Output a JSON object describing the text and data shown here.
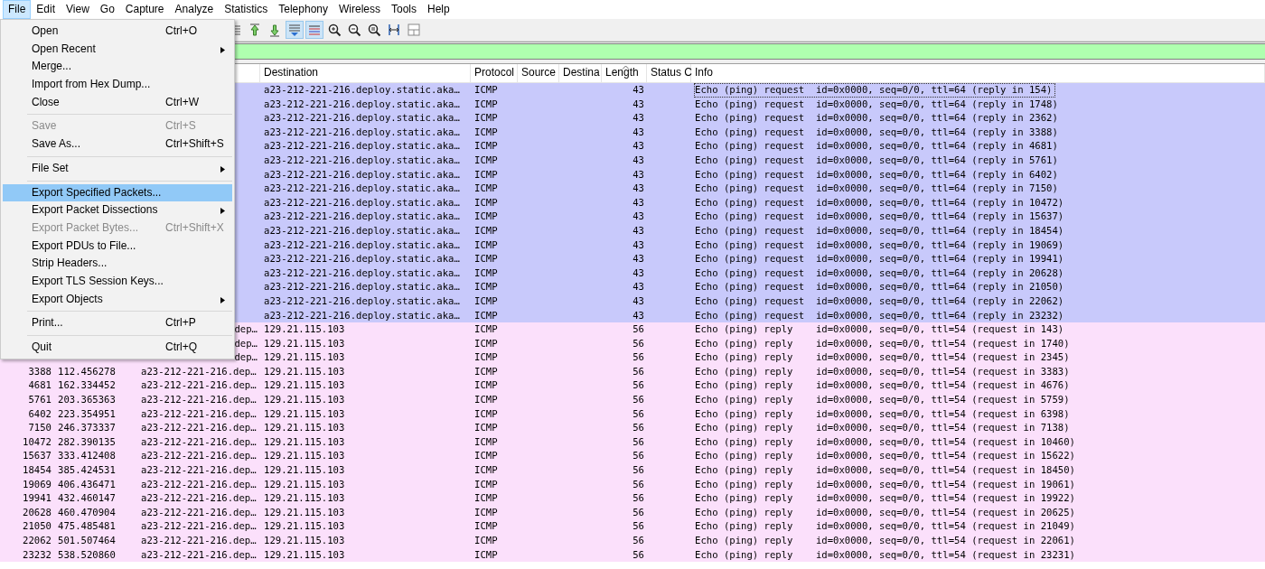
{
  "menubar": [
    {
      "label": "File",
      "selected": true
    },
    {
      "label": "Edit",
      "selected": false
    },
    {
      "label": "View",
      "selected": false
    },
    {
      "label": "Go",
      "selected": false
    },
    {
      "label": "Capture",
      "selected": false
    },
    {
      "label": "Analyze",
      "selected": false
    },
    {
      "label": "Statistics",
      "selected": false
    },
    {
      "label": "Telephony",
      "selected": false
    },
    {
      "label": "Wireless",
      "selected": false
    },
    {
      "label": "Tools",
      "selected": false
    },
    {
      "label": "Help",
      "selected": false
    }
  ],
  "file_menu": [
    {
      "kind": "item",
      "label": "Open",
      "shortcut": "Ctrl+O",
      "submenu": false,
      "disabled": false,
      "selected": false
    },
    {
      "kind": "item",
      "label": "Open Recent",
      "submenu": true,
      "disabled": false,
      "selected": false
    },
    {
      "kind": "item",
      "label": "Merge...",
      "submenu": false,
      "disabled": false,
      "selected": false
    },
    {
      "kind": "item",
      "label": "Import from Hex Dump...",
      "submenu": false,
      "disabled": false,
      "selected": false
    },
    {
      "kind": "item",
      "label": "Close",
      "shortcut": "Ctrl+W",
      "submenu": false,
      "disabled": false,
      "selected": false
    },
    {
      "kind": "separator"
    },
    {
      "kind": "item",
      "label": "Save",
      "shortcut": "Ctrl+S",
      "submenu": false,
      "disabled": true,
      "selected": false
    },
    {
      "kind": "item",
      "label": "Save As...",
      "shortcut": "Ctrl+Shift+S",
      "submenu": false,
      "disabled": false,
      "selected": false
    },
    {
      "kind": "separator"
    },
    {
      "kind": "item",
      "label": "File Set",
      "submenu": true,
      "disabled": false,
      "selected": false
    },
    {
      "kind": "separator"
    },
    {
      "kind": "item",
      "label": "Export Specified Packets...",
      "submenu": false,
      "disabled": false,
      "selected": true
    },
    {
      "kind": "item",
      "label": "Export Packet Dissections",
      "submenu": true,
      "disabled": false,
      "selected": false
    },
    {
      "kind": "item",
      "label": "Export Packet Bytes...",
      "shortcut": "Ctrl+Shift+X",
      "submenu": false,
      "disabled": true,
      "selected": false
    },
    {
      "kind": "item",
      "label": "Export PDUs to File...",
      "submenu": false,
      "disabled": false,
      "selected": false
    },
    {
      "kind": "item",
      "label": "Strip Headers...",
      "submenu": false,
      "disabled": false,
      "selected": false
    },
    {
      "kind": "item",
      "label": "Export TLS Session Keys...",
      "submenu": false,
      "disabled": false,
      "selected": false
    },
    {
      "kind": "item",
      "label": "Export Objects",
      "submenu": true,
      "disabled": false,
      "selected": false
    },
    {
      "kind": "separator"
    },
    {
      "kind": "item",
      "label": "Print...",
      "shortcut": "Ctrl+P",
      "submenu": false,
      "disabled": false,
      "selected": false
    },
    {
      "kind": "separator"
    },
    {
      "kind": "item",
      "label": "Quit",
      "shortcut": "Ctrl+Q",
      "submenu": false,
      "disabled": false,
      "selected": false
    }
  ],
  "toolbar": [
    {
      "kind": "lines",
      "pressed": false
    },
    {
      "kind": "first",
      "pressed": false
    },
    {
      "kind": "last",
      "pressed": false
    },
    {
      "kind": "autoscroll",
      "pressed": true
    },
    {
      "kind": "colorize",
      "pressed": true
    },
    {
      "kind": "zoomin",
      "pressed": false
    },
    {
      "kind": "zoomout",
      "pressed": false
    },
    {
      "kind": "zoomreset",
      "pressed": false
    },
    {
      "kind": "resize",
      "pressed": false
    },
    {
      "kind": "layout",
      "pressed": false
    }
  ],
  "packet_list": {
    "columns": [
      {
        "label": "Destination",
        "sorted": false
      },
      {
        "label": "Protocol",
        "sorted": false
      },
      {
        "label": "Source",
        "sorted": false
      },
      {
        "label": "Destina",
        "sorted": false
      },
      {
        "label": "Length",
        "sorted": true
      },
      {
        "label": "Status C",
        "sorted": false
      },
      {
        "label": "Info",
        "sorted": false
      }
    ],
    "rows": [
      {
        "kind": "request",
        "focused": true,
        "destination": "a23-212-221-216.deploy.static.aka…",
        "protocol": "ICMP",
        "length": "43",
        "info": "Echo (ping) request  id=0x0000, seq=0/0, ttl=64 (reply in 154)"
      },
      {
        "kind": "request",
        "focused": false,
        "destination": "a23-212-221-216.deploy.static.aka…",
        "protocol": "ICMP",
        "length": "43",
        "info": "Echo (ping) request  id=0x0000, seq=0/0, ttl=64 (reply in 1748)"
      },
      {
        "kind": "request",
        "focused": false,
        "destination": "a23-212-221-216.deploy.static.aka…",
        "protocol": "ICMP",
        "length": "43",
        "info": "Echo (ping) request  id=0x0000, seq=0/0, ttl=64 (reply in 2362)"
      },
      {
        "kind": "request",
        "focused": false,
        "destination": "a23-212-221-216.deploy.static.aka…",
        "protocol": "ICMP",
        "length": "43",
        "info": "Echo (ping) request  id=0x0000, seq=0/0, ttl=64 (reply in 3388)"
      },
      {
        "kind": "request",
        "focused": false,
        "destination": "a23-212-221-216.deploy.static.aka…",
        "protocol": "ICMP",
        "length": "43",
        "info": "Echo (ping) request  id=0x0000, seq=0/0, ttl=64 (reply in 4681)"
      },
      {
        "kind": "request",
        "focused": false,
        "destination": "a23-212-221-216.deploy.static.aka…",
        "protocol": "ICMP",
        "length": "43",
        "info": "Echo (ping) request  id=0x0000, seq=0/0, ttl=64 (reply in 5761)"
      },
      {
        "kind": "request",
        "focused": false,
        "destination": "a23-212-221-216.deploy.static.aka…",
        "protocol": "ICMP",
        "length": "43",
        "info": "Echo (ping) request  id=0x0000, seq=0/0, ttl=64 (reply in 6402)"
      },
      {
        "kind": "request",
        "focused": false,
        "destination": "a23-212-221-216.deploy.static.aka…",
        "protocol": "ICMP",
        "length": "43",
        "info": "Echo (ping) request  id=0x0000, seq=0/0, ttl=64 (reply in 7150)"
      },
      {
        "kind": "request",
        "focused": false,
        "destination": "a23-212-221-216.deploy.static.aka…",
        "protocol": "ICMP",
        "length": "43",
        "info": "Echo (ping) request  id=0x0000, seq=0/0, ttl=64 (reply in 10472)"
      },
      {
        "kind": "request",
        "focused": false,
        "destination": "a23-212-221-216.deploy.static.aka…",
        "protocol": "ICMP",
        "length": "43",
        "info": "Echo (ping) request  id=0x0000, seq=0/0, ttl=64 (reply in 15637)"
      },
      {
        "kind": "request",
        "focused": false,
        "destination": "a23-212-221-216.deploy.static.aka…",
        "protocol": "ICMP",
        "length": "43",
        "info": "Echo (ping) request  id=0x0000, seq=0/0, ttl=64 (reply in 18454)"
      },
      {
        "kind": "request",
        "focused": false,
        "destination": "a23-212-221-216.deploy.static.aka…",
        "protocol": "ICMP",
        "length": "43",
        "info": "Echo (ping) request  id=0x0000, seq=0/0, ttl=64 (reply in 19069)"
      },
      {
        "kind": "request",
        "focused": false,
        "destination": "a23-212-221-216.deploy.static.aka…",
        "protocol": "ICMP",
        "length": "43",
        "info": "Echo (ping) request  id=0x0000, seq=0/0, ttl=64 (reply in 19941)"
      },
      {
        "kind": "request",
        "focused": false,
        "destination": "a23-212-221-216.deploy.static.aka…",
        "protocol": "ICMP",
        "length": "43",
        "info": "Echo (ping) request  id=0x0000, seq=0/0, ttl=64 (reply in 20628)"
      },
      {
        "kind": "request",
        "focused": false,
        "destination": "a23-212-221-216.deploy.static.aka…",
        "protocol": "ICMP",
        "length": "43",
        "info": "Echo (ping) request  id=0x0000, seq=0/0, ttl=64 (reply in 21050)"
      },
      {
        "kind": "request",
        "focused": false,
        "destination": "a23-212-221-216.deploy.static.aka…",
        "protocol": "ICMP",
        "length": "43",
        "info": "Echo (ping) request  id=0x0000, seq=0/0, ttl=64 (reply in 22062)"
      },
      {
        "kind": "request",
        "focused": false,
        "destination": "a23-212-221-216.deploy.static.aka…",
        "protocol": "ICMP",
        "length": "43",
        "info": "Echo (ping) request  id=0x0000, seq=0/0, ttl=64 (reply in 23232)"
      },
      {
        "kind": "reply",
        "focused": false,
        "source_tail": "dep…",
        "destination": "129.21.115.103",
        "protocol": "ICMP",
        "length": "56",
        "info": "Echo (ping) reply    id=0x0000, seq=0/0, ttl=54 (request in 143)"
      },
      {
        "kind": "reply",
        "focused": false,
        "source_tail": "dep…",
        "destination": "129.21.115.103",
        "protocol": "ICMP",
        "length": "56",
        "info": "Echo (ping) reply    id=0x0000, seq=0/0, ttl=54 (request in 1740)"
      },
      {
        "kind": "reply",
        "focused": false,
        "source_tail": "dep…",
        "destination": "129.21.115.103",
        "protocol": "ICMP",
        "length": "56",
        "info": "Echo (ping) reply    id=0x0000, seq=0/0, ttl=54 (request in 2345)"
      },
      {
        "kind": "reply",
        "focused": false,
        "no": "3388",
        "time": "112.456278",
        "source": "a23-212-221-216.dep…",
        "destination": "129.21.115.103",
        "protocol": "ICMP",
        "length": "56",
        "info": "Echo (ping) reply    id=0x0000, seq=0/0, ttl=54 (request in 3383)"
      },
      {
        "kind": "reply",
        "focused": false,
        "no": "4681",
        "time": "162.334452",
        "source": "a23-212-221-216.dep…",
        "destination": "129.21.115.103",
        "protocol": "ICMP",
        "length": "56",
        "info": "Echo (ping) reply    id=0x0000, seq=0/0, ttl=54 (request in 4676)"
      },
      {
        "kind": "reply",
        "focused": false,
        "no": "5761",
        "time": "203.365363",
        "source": "a23-212-221-216.dep…",
        "destination": "129.21.115.103",
        "protocol": "ICMP",
        "length": "56",
        "info": "Echo (ping) reply    id=0x0000, seq=0/0, ttl=54 (request in 5759)"
      },
      {
        "kind": "reply",
        "focused": false,
        "no": "6402",
        "time": "223.354951",
        "source": "a23-212-221-216.dep…",
        "destination": "129.21.115.103",
        "protocol": "ICMP",
        "length": "56",
        "info": "Echo (ping) reply    id=0x0000, seq=0/0, ttl=54 (request in 6398)"
      },
      {
        "kind": "reply",
        "focused": false,
        "no": "7150",
        "time": "246.373337",
        "source": "a23-212-221-216.dep…",
        "destination": "129.21.115.103",
        "protocol": "ICMP",
        "length": "56",
        "info": "Echo (ping) reply    id=0x0000, seq=0/0, ttl=54 (request in 7138)"
      },
      {
        "kind": "reply",
        "focused": false,
        "no": "10472",
        "time": "282.390135",
        "source": "a23-212-221-216.dep…",
        "destination": "129.21.115.103",
        "protocol": "ICMP",
        "length": "56",
        "info": "Echo (ping) reply    id=0x0000, seq=0/0, ttl=54 (request in 10460)"
      },
      {
        "kind": "reply",
        "focused": false,
        "no": "15637",
        "time": "333.412408",
        "source": "a23-212-221-216.dep…",
        "destination": "129.21.115.103",
        "protocol": "ICMP",
        "length": "56",
        "info": "Echo (ping) reply    id=0x0000, seq=0/0, ttl=54 (request in 15622)"
      },
      {
        "kind": "reply",
        "focused": false,
        "no": "18454",
        "time": "385.424531",
        "source": "a23-212-221-216.dep…",
        "destination": "129.21.115.103",
        "protocol": "ICMP",
        "length": "56",
        "info": "Echo (ping) reply    id=0x0000, seq=0/0, ttl=54 (request in 18450)"
      },
      {
        "kind": "reply",
        "focused": false,
        "no": "19069",
        "time": "406.436471",
        "source": "a23-212-221-216.dep…",
        "destination": "129.21.115.103",
        "protocol": "ICMP",
        "length": "56",
        "info": "Echo (ping) reply    id=0x0000, seq=0/0, ttl=54 (request in 19061)"
      },
      {
        "kind": "reply",
        "focused": false,
        "no": "19941",
        "time": "432.460147",
        "source": "a23-212-221-216.dep…",
        "destination": "129.21.115.103",
        "protocol": "ICMP",
        "length": "56",
        "info": "Echo (ping) reply    id=0x0000, seq=0/0, ttl=54 (request in 19922)"
      },
      {
        "kind": "reply",
        "focused": false,
        "no": "20628",
        "time": "460.470904",
        "source": "a23-212-221-216.dep…",
        "destination": "129.21.115.103",
        "protocol": "ICMP",
        "length": "56",
        "info": "Echo (ping) reply    id=0x0000, seq=0/0, ttl=54 (request in 20625)"
      },
      {
        "kind": "reply",
        "focused": false,
        "no": "21050",
        "time": "475.485481",
        "source": "a23-212-221-216.dep…",
        "destination": "129.21.115.103",
        "protocol": "ICMP",
        "length": "56",
        "info": "Echo (ping) reply    id=0x0000, seq=0/0, ttl=54 (request in 21049)"
      },
      {
        "kind": "reply",
        "focused": false,
        "no": "22062",
        "time": "501.507464",
        "source": "a23-212-221-216.dep…",
        "destination": "129.21.115.103",
        "protocol": "ICMP",
        "length": "56",
        "info": "Echo (ping) reply    id=0x0000, seq=0/0, ttl=54 (request in 22061)"
      },
      {
        "kind": "reply",
        "focused": false,
        "no": "23232",
        "time": "538.520860",
        "source": "a23-212-221-216.dep…",
        "destination": "129.21.115.103",
        "protocol": "ICMP",
        "length": "56",
        "info": "Echo (ping) reply    id=0x0000, seq=0/0, ttl=54 (request in 23231)"
      }
    ]
  }
}
